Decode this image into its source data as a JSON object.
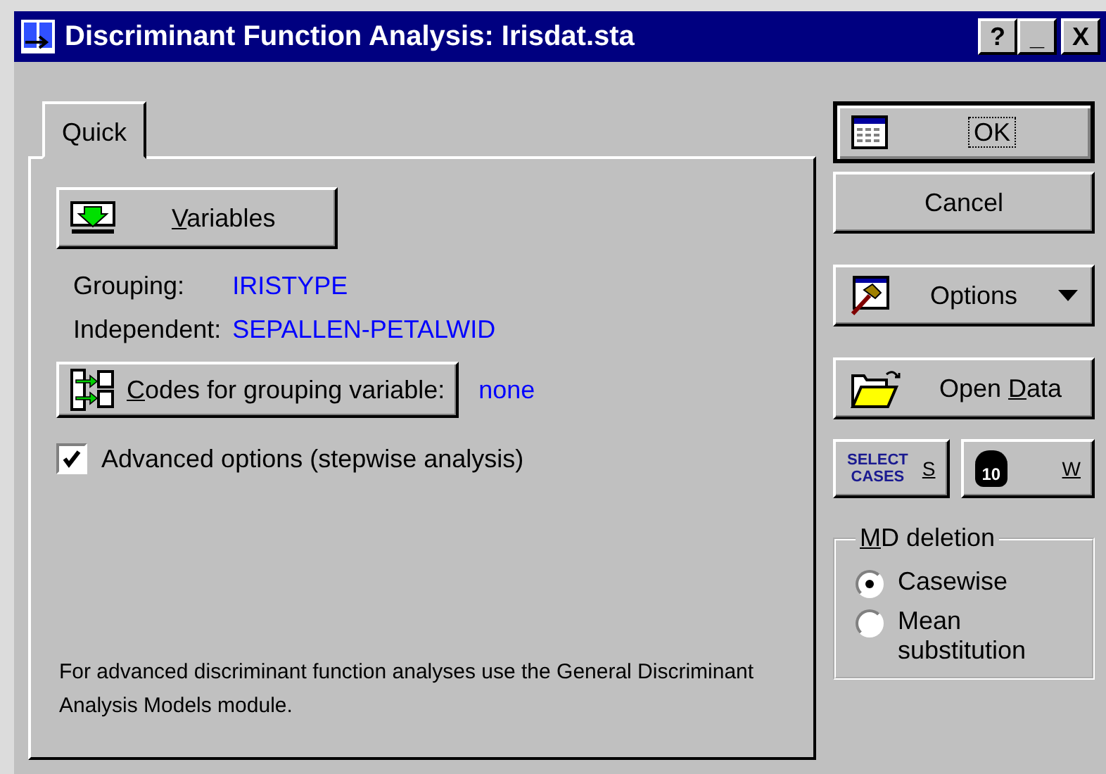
{
  "window": {
    "title": "Discriminant Function Analysis: Irisdat.sta",
    "controls": [
      "?",
      "_",
      "X"
    ]
  },
  "tabs": [
    {
      "label": "Quick",
      "selected": true
    }
  ],
  "variables_button": {
    "key": "V",
    "after": "ariables"
  },
  "fields": [
    {
      "label": "Grouping:",
      "value": "IRISTYPE"
    },
    {
      "label": "Independent:",
      "value": "SEPALLEN-PETALWID"
    }
  ],
  "codes_button": {
    "key": "C",
    "after": "odes for grouping variable:"
  },
  "codes_value": "none",
  "advanced_checkbox": {
    "label": "Advanced options (stepwise analysis)",
    "checked": true
  },
  "note": "For advanced discriminant function analyses use the General Discriminant Analysis Models module.",
  "buttons": {
    "ok": {
      "after": "OK"
    },
    "cancel": {
      "after": "Cancel"
    },
    "options": {
      "after": "Options"
    },
    "open_data": {
      "before": "Open ",
      "key": "D",
      "after": "ata"
    }
  },
  "select_cases": {
    "icon_lines": [
      "SELECT",
      "CASES"
    ],
    "key": "S"
  },
  "weight": {
    "icon_text": "10",
    "key": "W"
  },
  "md_deletion": {
    "key": "M",
    "after": "D deletion",
    "options": [
      {
        "label": "Casewise",
        "selected": true
      },
      {
        "label": "Mean substitution",
        "selected": false
      }
    ]
  }
}
